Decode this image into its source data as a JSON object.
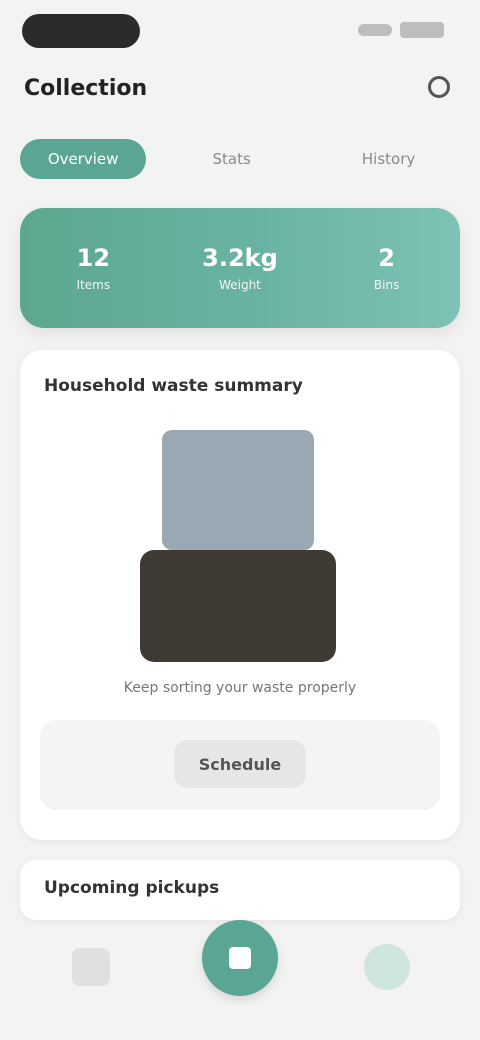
{
  "status": {
    "time": ""
  },
  "header": {
    "title": "Collection",
    "settings_icon": "settings-icon"
  },
  "tabs": [
    {
      "label": "Overview",
      "active": true
    },
    {
      "label": "Stats",
      "active": false
    },
    {
      "label": "History",
      "active": false
    }
  ],
  "summary": {
    "stats": [
      {
        "value": "12",
        "label": "Items"
      },
      {
        "value": "3.2kg",
        "label": "Weight"
      },
      {
        "value": "2",
        "label": "Bins"
      }
    ]
  },
  "content": {
    "section_title": "Household waste summary",
    "caption": "Keep sorting your waste properly",
    "action_label": "Schedule"
  },
  "section2": {
    "title": "Upcoming pickups"
  },
  "colors": {
    "accent": "#5aa593",
    "card": "#ffffff",
    "background": "#f3f3f3"
  }
}
